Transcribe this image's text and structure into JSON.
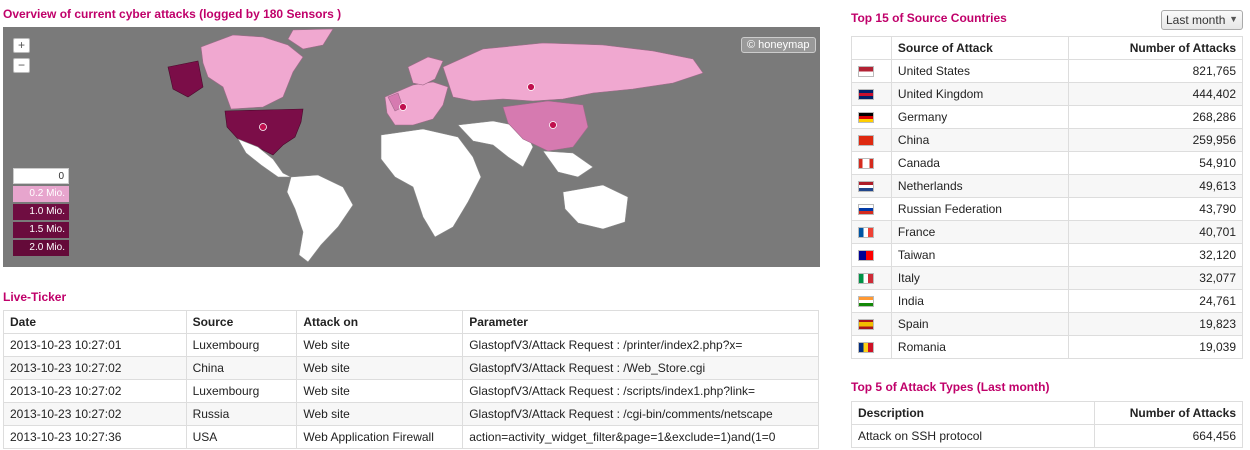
{
  "map": {
    "heading": "Overview of current cyber attacks (logged by 180 Sensors )",
    "zoom_in": "+",
    "zoom_out": "−",
    "badge": "© honeymap",
    "legend": [
      "0",
      "0.2 Mio.",
      "1.0 Mio.",
      "1.5 Mio.",
      "2.0 Mio."
    ],
    "colors": {
      "ocean": "#7a7a7a",
      "land": "#ffffff",
      "low": "#f0a8d0",
      "mid": "#d67ab0",
      "high": "#7b0d48",
      "marker": "#c0104e"
    }
  },
  "ticker": {
    "heading": "Live-Ticker",
    "columns": [
      "Date",
      "Source",
      "Attack on",
      "Parameter"
    ],
    "rows": [
      [
        "2013-10-23 10:27:01",
        "Luxembourg",
        "Web site",
        "GlastopfV3/Attack Request : /printer/index2.php?x="
      ],
      [
        "2013-10-23 10:27:02",
        "China",
        "Web site",
        "GlastopfV3/Attack Request : /Web_Store.cgi"
      ],
      [
        "2013-10-23 10:27:02",
        "Luxembourg",
        "Web site",
        "GlastopfV3/Attack Request : /scripts/index1.php?link="
      ],
      [
        "2013-10-23 10:27:02",
        "Russia",
        "Web site",
        "GlastopfV3/Attack Request : /cgi-bin/comments/netscape"
      ],
      [
        "2013-10-23 10:27:36",
        "USA",
        "Web Application Firewall",
        "action=activity_widget_filter&page=1&exclude=1)and(1=0"
      ]
    ]
  },
  "countries": {
    "heading": "Top 15 of Source Countries",
    "period_select": "Last month",
    "columns": [
      "Source of Attack",
      "Number of Attacks"
    ],
    "rows": [
      {
        "flag": "us-flag-icon",
        "country": "United States",
        "attacks": "821,765"
      },
      {
        "flag": "uk-flag-icon",
        "country": "United Kingdom",
        "attacks": "444,402"
      },
      {
        "flag": "de-flag-icon",
        "country": "Germany",
        "attacks": "268,286"
      },
      {
        "flag": "cn-flag-icon",
        "country": "China",
        "attacks": "259,956"
      },
      {
        "flag": "ca-flag-icon",
        "country": "Canada",
        "attacks": "54,910"
      },
      {
        "flag": "nl-flag-icon",
        "country": "Netherlands",
        "attacks": "49,613"
      },
      {
        "flag": "ru-flag-icon",
        "country": "Russian Federation",
        "attacks": "43,790"
      },
      {
        "flag": "fr-flag-icon",
        "country": "France",
        "attacks": "40,701"
      },
      {
        "flag": "tw-flag-icon",
        "country": "Taiwan",
        "attacks": "32,120"
      },
      {
        "flag": "it-flag-icon",
        "country": "Italy",
        "attacks": "32,077"
      },
      {
        "flag": "in-flag-icon",
        "country": "India",
        "attacks": "24,761"
      },
      {
        "flag": "es-flag-icon",
        "country": "Spain",
        "attacks": "19,823"
      },
      {
        "flag": "ro-flag-icon",
        "country": "Romania",
        "attacks": "19,039"
      }
    ]
  },
  "types": {
    "heading": "Top 5 of Attack Types (Last month)",
    "columns": [
      "Description",
      "Number of Attacks"
    ],
    "rows": [
      {
        "description": "Attack on SSH protocol",
        "attacks": "664,456"
      }
    ]
  }
}
